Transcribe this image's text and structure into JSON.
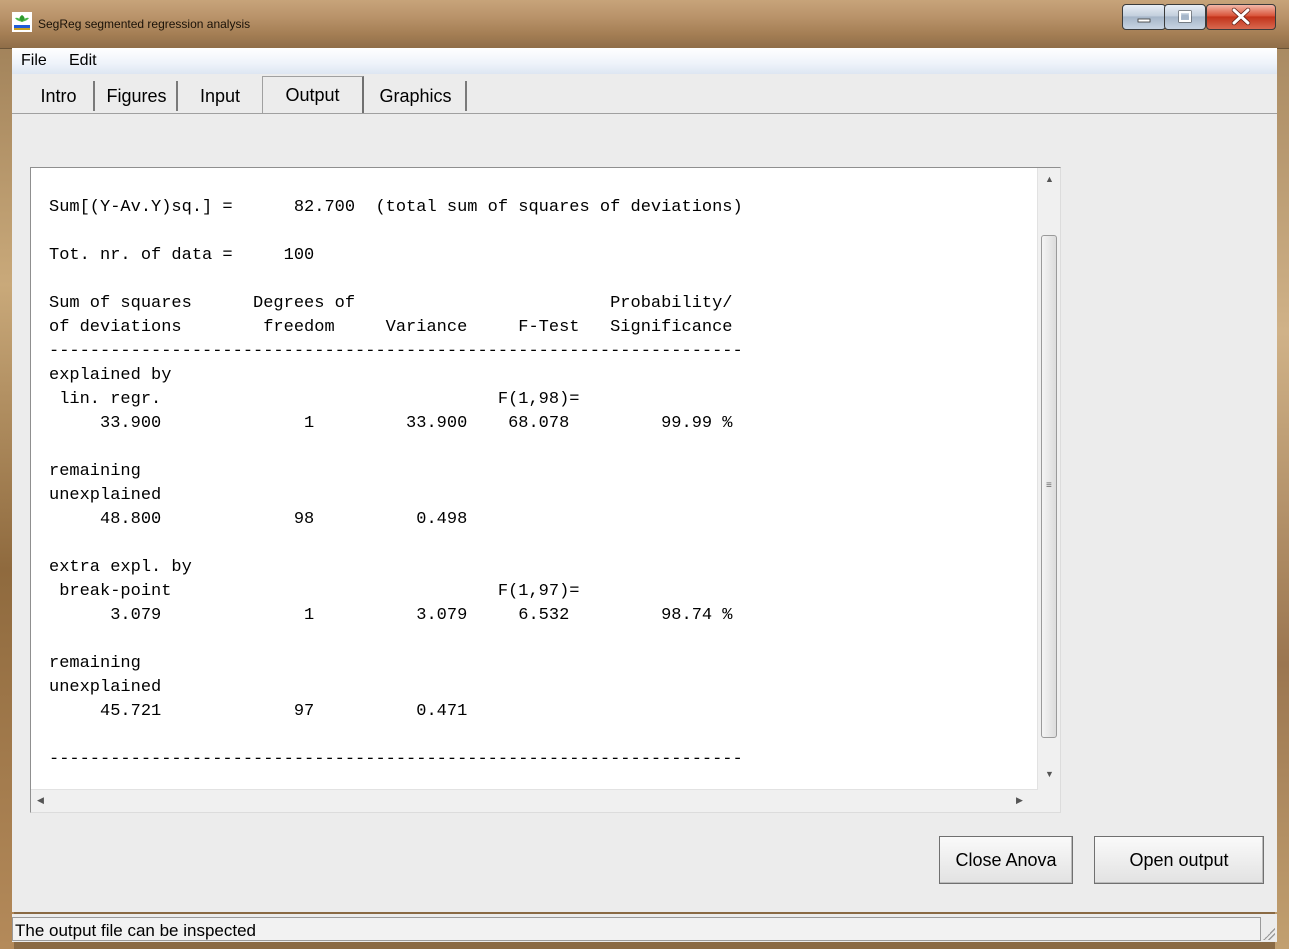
{
  "window": {
    "title": "SegReg segmented regression analysis",
    "icons": {
      "app": "segreg-app-icon",
      "min": "minimize-icon",
      "max": "maximize-icon",
      "close": "close-icon"
    }
  },
  "menu": {
    "file": "File",
    "edit": "Edit"
  },
  "tabs": {
    "intro": "Intro",
    "figures": "Figures",
    "input": "Input",
    "output": "Output",
    "graphics": "Graphics",
    "selected": "Output"
  },
  "output": {
    "text": "Sum[(Y-Av.Y)sq.] =      82.700  (total sum of squares of deviations)\n\nTot. nr. of data =     100\n\nSum of squares      Degrees of                         Probability/\nof deviations        freedom     Variance     F-Test   Significance\n--------------------------------------------------------------------\nexplained by\n lin. regr.                                 F(1,98)=\n     33.900              1         33.900    68.078         99.99 %\n\nremaining\nunexplained\n     48.800             98          0.498\n\nextra expl. by\n break-point                                F(1,97)=\n      3.079              1          3.079     6.532         98.74 %\n\nremaining\nunexplained\n     45.721             97          0.471\n\n--------------------------------------------------------------------"
  },
  "buttons": {
    "close_anova": "Close Anova",
    "open_output": "Open output"
  },
  "status": {
    "text": "The output file can be inspected"
  },
  "colors": {
    "accent_close": "#c2331a",
    "panel": "#ececec",
    "text": "#000000"
  }
}
